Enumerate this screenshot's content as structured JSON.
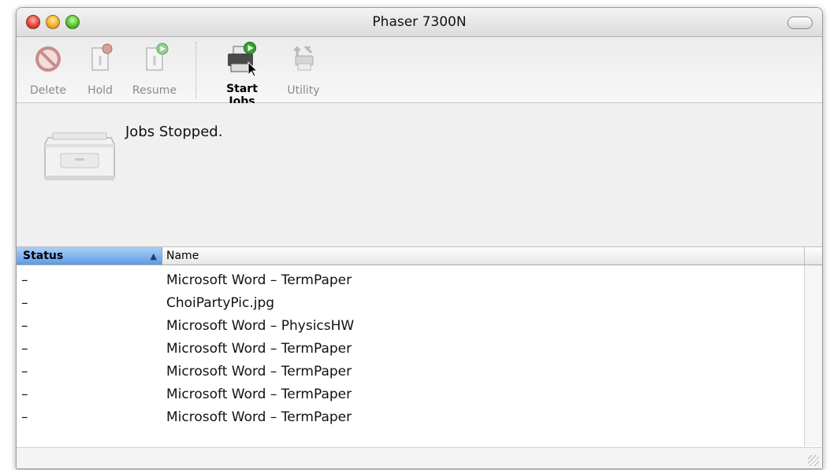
{
  "window": {
    "title": "Phaser 7300N"
  },
  "toolbar": {
    "delete_label": "Delete",
    "hold_label": "Hold",
    "resume_label": "Resume",
    "start_jobs_label": "Start Jobs",
    "utility_label": "Utility"
  },
  "status": {
    "message": "Jobs Stopped."
  },
  "table": {
    "columns": {
      "status": "Status",
      "name": "Name"
    },
    "sort_indicator": "▲",
    "rows": [
      {
        "status": "–",
        "name": "Microsoft Word – TermPaper"
      },
      {
        "status": "–",
        "name": "ChoiPartyPic.jpg"
      },
      {
        "status": "–",
        "name": "Microsoft Word – PhysicsHW"
      },
      {
        "status": "–",
        "name": "Microsoft Word – TermPaper"
      },
      {
        "status": "–",
        "name": "Microsoft Word – TermPaper"
      },
      {
        "status": "–",
        "name": "Microsoft Word – TermPaper"
      },
      {
        "status": "–",
        "name": "Microsoft Word – TermPaper"
      }
    ]
  },
  "colors": {
    "selected_header": "#5e9be3",
    "resume_green": "#2fa52f",
    "hold_red": "#c0392b"
  },
  "icons": {
    "delete": "no-entry-icon",
    "hold": "document-hold-icon",
    "resume": "document-resume-icon",
    "start_jobs": "printer-start-icon",
    "utility": "printer-utility-icon",
    "printer": "printer-icon"
  }
}
